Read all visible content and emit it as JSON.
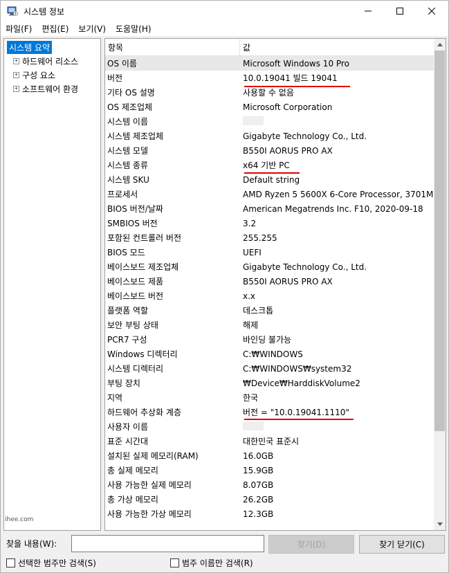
{
  "window": {
    "title": "시스템 정보",
    "controls": {
      "minimize": "─",
      "maximize": "☐",
      "close": "✕"
    }
  },
  "menu": [
    "파일(F)",
    "편집(E)",
    "보기(V)",
    "도움말(H)"
  ],
  "tree": {
    "root": "시스템 요약",
    "children": [
      {
        "expander": "+",
        "label": "하드웨어 리소스"
      },
      {
        "expander": "+",
        "label": "구성 요소"
      },
      {
        "expander": "+",
        "label": "소프트웨어 환경"
      }
    ],
    "watermark": "ihee.com"
  },
  "list": {
    "columns": {
      "item": "항목",
      "value": "값"
    },
    "rows": [
      {
        "item": "OS 이름",
        "value": "Microsoft Windows 10 Pro"
      },
      {
        "item": "버전",
        "value": "10.0.19041 빌드 19041"
      },
      {
        "item": "기타 OS 설명",
        "value": "사용할 수 없음"
      },
      {
        "item": "OS 제조업체",
        "value": "Microsoft Corporation"
      },
      {
        "item": "시스템 이름",
        "value": ""
      },
      {
        "item": "시스템 제조업체",
        "value": "Gigabyte Technology Co., Ltd."
      },
      {
        "item": "시스템 모델",
        "value": "B550I AORUS PRO AX"
      },
      {
        "item": "시스템 종류",
        "value": "x64 기반 PC"
      },
      {
        "item": "시스템 SKU",
        "value": "Default string"
      },
      {
        "item": "프로세서",
        "value": "AMD Ryzen 5 5600X 6-Core Processor, 3701M"
      },
      {
        "item": "BIOS 버전/날짜",
        "value": "American Megatrends Inc. F10, 2020-09-18"
      },
      {
        "item": "SMBIOS 버전",
        "value": "3.2"
      },
      {
        "item": "포함된 컨트롤러 버전",
        "value": "255.255"
      },
      {
        "item": "BIOS 모드",
        "value": "UEFI"
      },
      {
        "item": "베이스보드 제조업체",
        "value": "Gigabyte Technology Co., Ltd."
      },
      {
        "item": "베이스보드 제품",
        "value": "B550I AORUS PRO AX"
      },
      {
        "item": "베이스보드 버전",
        "value": "x.x"
      },
      {
        "item": "플랫폼 역할",
        "value": "데스크톱"
      },
      {
        "item": "보안 부팅 상태",
        "value": "해제"
      },
      {
        "item": "PCR7 구성",
        "value": "바인딩 불가능"
      },
      {
        "item": "Windows 디렉터리",
        "value": "C:₩WINDOWS"
      },
      {
        "item": "시스템 디렉터리",
        "value": "C:₩WINDOWS₩system32"
      },
      {
        "item": "부팅 장치",
        "value": "₩Device₩HarddiskVolume2"
      },
      {
        "item": "지역",
        "value": "한국"
      },
      {
        "item": "하드웨어 추상화 계층",
        "value": "버전 = \"10.0.19041.1110\""
      },
      {
        "item": "사용자 이름",
        "value": ""
      },
      {
        "item": "표준 시간대",
        "value": "대한민국 표준시"
      },
      {
        "item": "설치된 실제 메모리(RAM)",
        "value": "16.0GB"
      },
      {
        "item": "총 실제 메모리",
        "value": "15.9GB"
      },
      {
        "item": "사용 가능한 실제 메모리",
        "value": "8.07GB"
      },
      {
        "item": "총 가상 메모리",
        "value": "26.2GB"
      },
      {
        "item": "사용 가능한 가상 메모리",
        "value": "12.3GB"
      }
    ]
  },
  "search": {
    "find_label": "찾을 내용(W):",
    "find_value": "",
    "find_button": "찾기(D)",
    "close_find_button": "찾기 닫기(C)",
    "check_selected_only": "선택한 범주만 검색(S)",
    "check_names_only": "범주 이름만 검색(R)"
  },
  "colors": {
    "selection": "#0078d7",
    "annotation": "#e00000"
  }
}
